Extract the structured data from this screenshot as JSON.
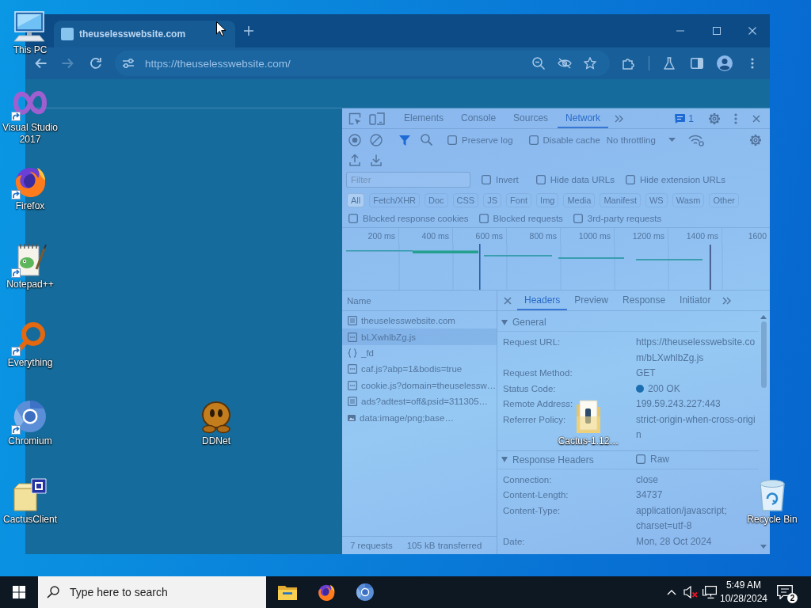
{
  "desktop": {
    "icons": [
      {
        "label": "This PC",
        "kind": "computer",
        "shortcut": false
      },
      {
        "label": "Visual Studio 2017",
        "kind": "infinity",
        "shortcut": true
      },
      {
        "label": "Firefox",
        "kind": "fox",
        "shortcut": true
      },
      {
        "label": "Notepad++",
        "kind": "notepad",
        "shortcut": true
      },
      {
        "label": "Everything",
        "kind": "magnifier",
        "shortcut": true
      },
      {
        "label": "Chromium",
        "kind": "ring",
        "shortcut": true
      },
      {
        "label": "CactusClient",
        "kind": "archive",
        "shortcut": false
      },
      {
        "label": "DDNet",
        "kind": "ball",
        "shortcut": false
      },
      {
        "label": "Cactus-1.12…",
        "kind": "folder",
        "shortcut": false
      },
      {
        "label": "Recycle Bin",
        "kind": "bin",
        "shortcut": false
      }
    ]
  },
  "browser": {
    "tabs": [
      {
        "title": "theuselesswebsite.com",
        "selected": true
      }
    ],
    "nav": [
      {
        "kind": "back",
        "disabled": false
      },
      {
        "kind": "forward",
        "disabled": true
      },
      {
        "kind": "reload",
        "disabled": false
      }
    ],
    "address": "https://theuselesswebsite.com/"
  },
  "devtools": {
    "tabs": [
      {
        "label": "Elements",
        "selected": false
      },
      {
        "label": "Console",
        "selected": false
      },
      {
        "label": "Sources",
        "selected": false
      },
      {
        "label": "Network",
        "selected": true
      }
    ],
    "issues_count": "1",
    "toolbar_options": [
      {
        "label": "Preserve log",
        "checked": false
      },
      {
        "label": "Disable cache",
        "checked": false
      }
    ],
    "throttling": "No throttling",
    "filter": {
      "placeholder": "Filter"
    },
    "filter_options": [
      {
        "label": "Invert",
        "checked": false
      },
      {
        "label": "Hide data URLs",
        "checked": false
      },
      {
        "label": "Hide extension URLs",
        "checked": false
      }
    ],
    "type_filters": [
      {
        "label": "All",
        "selected": true
      },
      {
        "label": "Fetch/XHR",
        "selected": false
      },
      {
        "label": "Doc",
        "selected": false
      },
      {
        "label": "CSS",
        "selected": false
      },
      {
        "label": "JS",
        "selected": false
      },
      {
        "label": "Font",
        "selected": false
      },
      {
        "label": "Img",
        "selected": false
      },
      {
        "label": "Media",
        "selected": false
      },
      {
        "label": "Manifest",
        "selected": false
      },
      {
        "label": "WS",
        "selected": false
      },
      {
        "label": "Wasm",
        "selected": false
      },
      {
        "label": "Other",
        "selected": false
      }
    ],
    "more_options": [
      {
        "label": "Blocked response cookies",
        "checked": false
      },
      {
        "label": "Blocked requests",
        "checked": false
      },
      {
        "label": "3rd-party requests",
        "checked": false
      }
    ],
    "timeline_ticks": [
      "200 ms",
      "400 ms",
      "600 ms",
      "800 ms",
      "1000 ms",
      "1200 ms",
      "1400 ms",
      "1600"
    ],
    "requests": {
      "header": "Name",
      "rows": [
        {
          "name": "theuselesswebsite.com",
          "kind": "document",
          "selected": false
        },
        {
          "name": "bLXwhlbZg.js",
          "kind": "script",
          "selected": true
        },
        {
          "name": "_fd",
          "kind": "fetch",
          "selected": false
        },
        {
          "name": "caf.js?abp=1&bodis=true",
          "kind": "script",
          "selected": false
        },
        {
          "name": "cookie.js?domain=theuselessw…",
          "kind": "script",
          "selected": false
        },
        {
          "name": "ads?adtest=off&psid=311305…",
          "kind": "document",
          "selected": false
        },
        {
          "name": "data:image/png;base…",
          "kind": "image",
          "selected": false
        }
      ],
      "count": "7 requests",
      "transferred": "105 kB transferred"
    },
    "details": {
      "tabs": [
        {
          "label": "Headers",
          "selected": true
        },
        {
          "label": "Preview",
          "selected": false
        },
        {
          "label": "Response",
          "selected": false
        },
        {
          "label": "Initiator",
          "selected": false
        }
      ],
      "sections": [
        {
          "title": "General",
          "expanded": true,
          "rows": [
            {
              "name": "Request URL:",
              "value": "https://theuselesswebsite.com/bLXwhlbZg.js"
            },
            {
              "name": "Request Method:",
              "value": "GET"
            },
            {
              "name": "Status Code:",
              "value": "200 OK",
              "color": "#1b6fb0"
            },
            {
              "name": "Remote Address:",
              "value": "199.59.243.227:443"
            },
            {
              "name": "Referrer Policy:",
              "value": "strict-origin-when-cross-origin"
            }
          ]
        },
        {
          "title": "Response Headers",
          "expanded": true,
          "raw": {
            "label": "Raw",
            "checked": false
          },
          "rows": [
            {
              "name": "Connection:",
              "value": "close"
            },
            {
              "name": "Content-Length:",
              "value": "34737"
            },
            {
              "name": "Content-Type:",
              "value": "application/javascript; charset=utf-8"
            },
            {
              "name": "Date:",
              "value": "Mon, 28 Oct 2024"
            }
          ]
        }
      ]
    }
  },
  "taskbar": {
    "search": {
      "placeholder": "Type here to search"
    },
    "apps": [
      {
        "kind": "folder"
      },
      {
        "kind": "fox"
      },
      {
        "kind": "ring"
      }
    ],
    "clock": {
      "time": "5:49 AM",
      "date": "10/28/2024"
    },
    "notifications": "2"
  }
}
